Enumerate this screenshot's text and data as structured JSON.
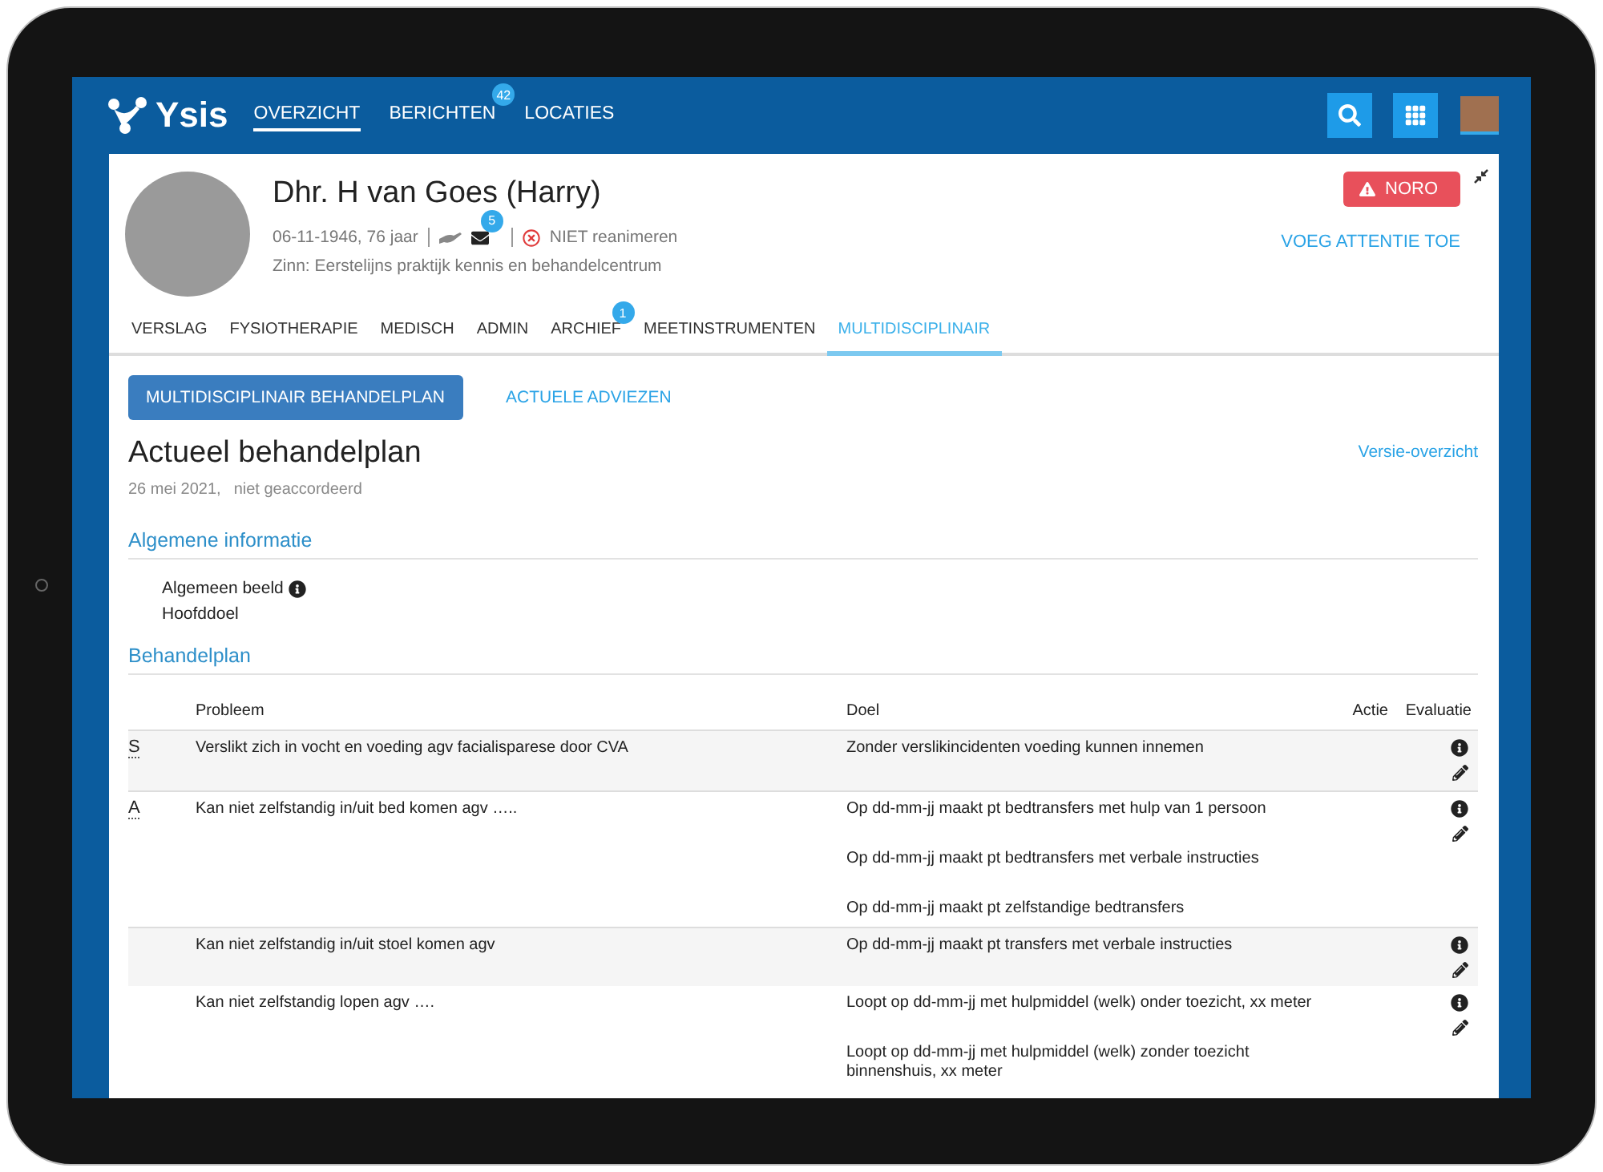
{
  "header": {
    "logo": "Ysis",
    "nav": [
      {
        "label": "OVERZICHT",
        "selected": true
      },
      {
        "label": "BERICHTEN",
        "selected": false,
        "badge": "42"
      },
      {
        "label": "LOCATIES",
        "selected": false
      }
    ]
  },
  "patient": {
    "name": "Dhr. H van Goes (Harry)",
    "birth": "06-11-1946, 76 jaar",
    "mail_badge": "5",
    "resuscitation": "NIET reanimeren",
    "location": "Zinn: Eerstelijns praktijk kennis en behandelcentrum",
    "alert": "NORO",
    "action": "VOEG ATTENTIE TOE"
  },
  "tabs": [
    {
      "label": "VERSLAG",
      "selected": false
    },
    {
      "label": "FYSIOTHERAPIE",
      "selected": false
    },
    {
      "label": "MEDISCH",
      "selected": false
    },
    {
      "label": "ADMIN",
      "selected": false
    },
    {
      "label": "ARCHIEF",
      "selected": false,
      "badge": "1"
    },
    {
      "label": "MEETINSTRUMENTEN",
      "selected": false
    },
    {
      "label": "MULTIDISCIPLINAIR",
      "selected": true
    }
  ],
  "subtabs": [
    {
      "label": "MULTIDISCIPLINAIR BEHANDELPLAN",
      "selected": true
    },
    {
      "label": "ACTUELE ADVIEZEN",
      "selected": false
    }
  ],
  "plan": {
    "title": "Actueel behandelplan",
    "date": "26 mei 2021,",
    "status": "niet geaccordeerd",
    "version_link": "Versie-overzicht"
  },
  "general": {
    "heading": "Algemene informatie",
    "items": [
      {
        "label": "Algemeen beeld",
        "info": true
      },
      {
        "label": "Hoofddoel",
        "info": false
      }
    ]
  },
  "treatment": {
    "heading": "Behandelplan",
    "columns": [
      "Probleem",
      "Doel",
      "Actie",
      "Evaluatie"
    ],
    "rows": [
      {
        "marker": "S",
        "problem": "Verslikt zich in vocht en voeding agv facialisparese door CVA",
        "goals": [
          "Zonder verslikincidenten voeding kunnen innemen"
        ]
      },
      {
        "marker": "A",
        "problem": "Kan niet zelfstandig in/uit bed komen agv …..",
        "goals": [
          "Op dd-mm-jj maakt pt bedtransfers met hulp van 1 persoon",
          "Op dd-mm-jj maakt pt bedtransfers met verbale instructies",
          "Op dd-mm-jj maakt pt zelfstandige bedtransfers"
        ]
      },
      {
        "problem": "Kan niet zelfstandig in/uit stoel komen agv",
        "goals": [
          "Op dd-mm-jj maakt pt transfers met verbale instructies"
        ]
      },
      {
        "problem": "Kan niet zelfstandig lopen agv ….",
        "goals": [
          "Loopt op dd-mm-jj met hulpmiddel (welk) onder toezicht, xx meter",
          "Loopt op dd-mm-jj met hulpmiddel (welk) zonder toezicht binnenshuis, xx meter"
        ]
      }
    ]
  }
}
